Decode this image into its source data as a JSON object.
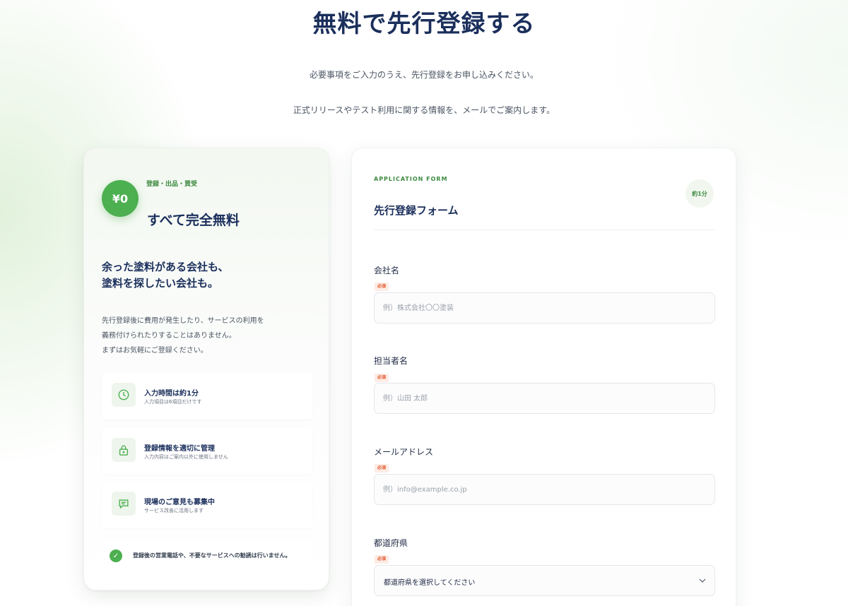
{
  "hero": {
    "title": "無料で先行登録する",
    "lead_1": "必要事項をご入力のうえ、先行登録をお申し込みください。",
    "lead_2": "正式リリースやテスト利用に関する情報を、メールでご案内します。"
  },
  "left_card": {
    "badge": "¥0",
    "eyebrow": "登録・出品・買受",
    "title": "すべて完全無料",
    "catch_line_1": "余った塗料がある会社も、",
    "catch_line_2": "塗料を探したい会社も。",
    "desc_line_1": "先行登録後に費用が発生したり、サービスの利用を",
    "desc_line_2": "義務付けられたりすることはありません。",
    "desc_line_3": "まずはお気軽にご登録ください。",
    "features": [
      {
        "icon": "clock-icon",
        "title": "入力時間は約1分",
        "sub": "入力項目は6項目だけです"
      },
      {
        "icon": "lock-icon",
        "title": "登録情報を適切に管理",
        "sub": "入力内容はご案内以外に使用しません"
      },
      {
        "icon": "chat-icon",
        "title": "現場のご意見も募集中",
        "sub": "サービス改善に活用します"
      }
    ],
    "note": "登録後の営業電話や、不要なサービスへの勧誘は行いません。"
  },
  "form": {
    "eyebrow": "APPLICATION FORM",
    "title": "先行登録フォーム",
    "time_badge": "約1分",
    "required_label": "必須",
    "fields": [
      {
        "label": "会社名",
        "placeholder": "例）株式会社〇〇塗装",
        "value": ""
      },
      {
        "label": "担当者名",
        "placeholder": "例）山田 太郎",
        "value": ""
      },
      {
        "label": "メールアドレス",
        "placeholder": "例）info@example.co.jp",
        "value": ""
      }
    ],
    "prefecture": {
      "label": "都道府県",
      "selected": "都道府県を選択してください"
    }
  },
  "colors": {
    "brand_green": "#4caf50",
    "navy": "#1b2f5c",
    "required_red": "#e0552b"
  }
}
